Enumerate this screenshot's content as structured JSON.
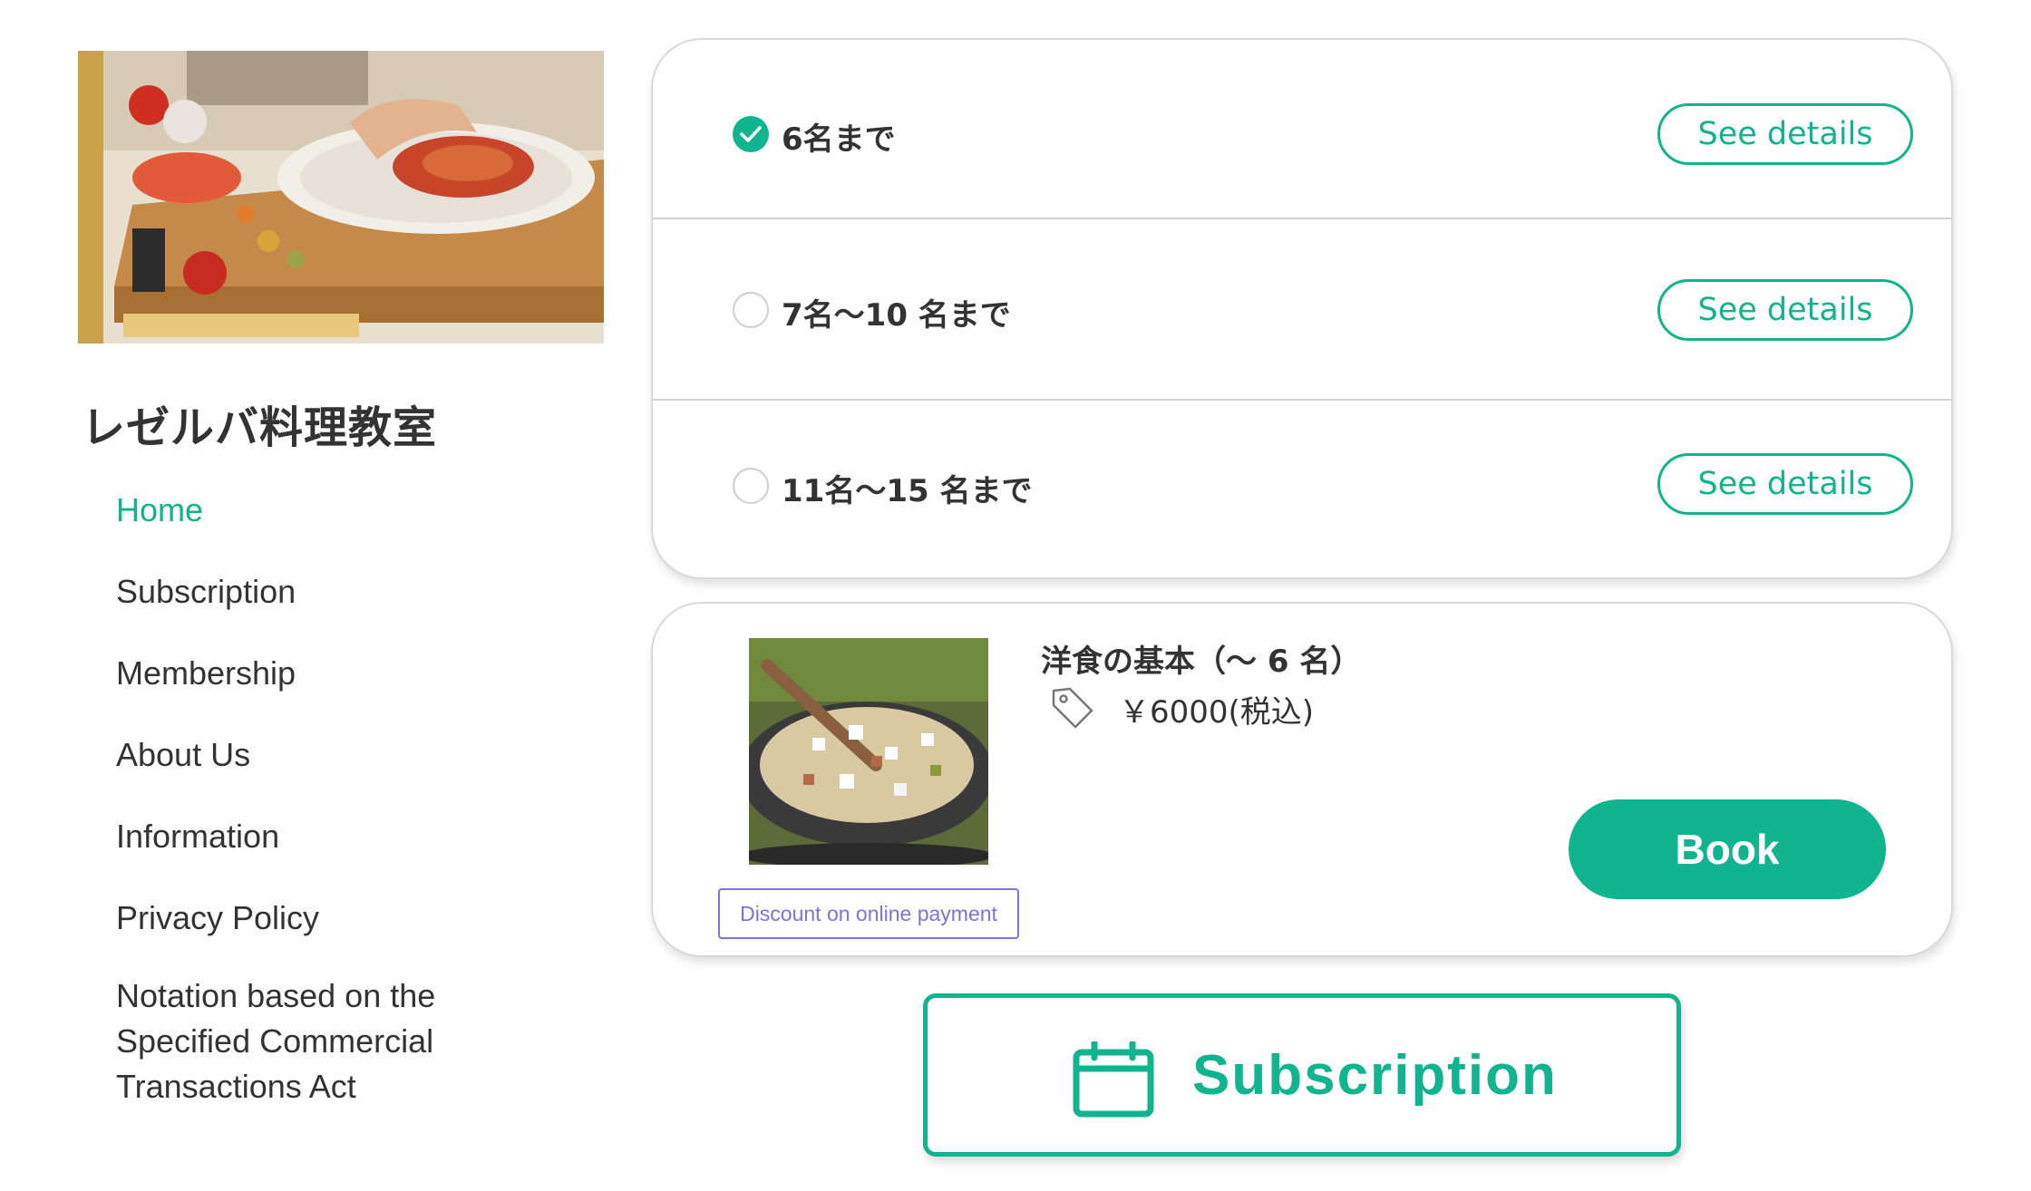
{
  "sidebar": {
    "title": "レゼルバ料理教室",
    "nav": [
      {
        "label": "Home",
        "active": true
      },
      {
        "label": "Subscription",
        "active": false
      },
      {
        "label": "Membership",
        "active": false
      },
      {
        "label": "About Us",
        "active": false
      },
      {
        "label": "Information",
        "active": false
      },
      {
        "label": "Privacy Policy",
        "active": false
      },
      {
        "label": "Notation based on the Specified Commercial Transactions Act",
        "active": false
      }
    ]
  },
  "plans": {
    "options": [
      {
        "label": "6名まで",
        "selected": true,
        "details_label": "See details"
      },
      {
        "label": "7名〜10 名まで",
        "selected": false,
        "details_label": "See details"
      },
      {
        "label": "11名〜15 名まで",
        "selected": false,
        "details_label": "See details"
      }
    ]
  },
  "course": {
    "name": "洋食の基本（〜 6 名）",
    "price": "￥6000(税込)",
    "discount_badge": "Discount on online payment",
    "book_label": "Book",
    "icons": {
      "price": "tag-icon"
    }
  },
  "subscription_button": {
    "label": "Subscription",
    "icon": "calendar-icon"
  },
  "colors": {
    "accent": "#10b48e",
    "discount": "#7d72e0",
    "text": "#333333"
  }
}
